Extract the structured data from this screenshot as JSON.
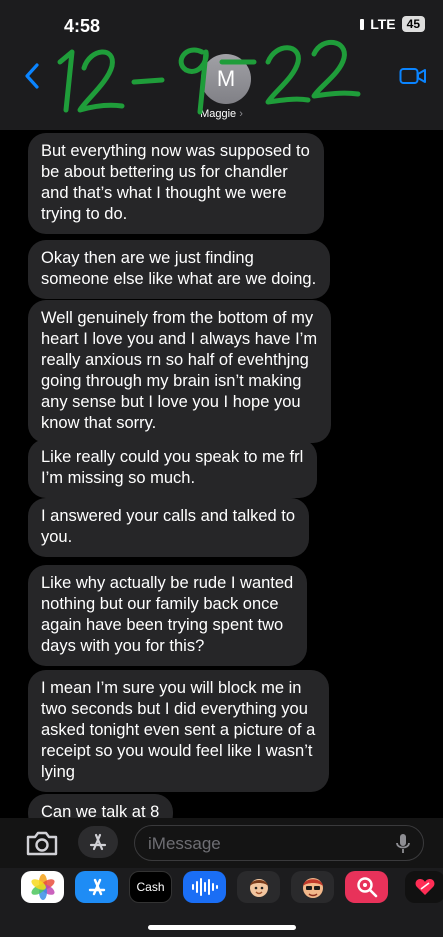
{
  "status_bar": {
    "time": "4:58",
    "network": "LTE",
    "battery": "45"
  },
  "contact": {
    "initial": "M",
    "name": "Maggie",
    "chevron": "›"
  },
  "annotation_text": "12-9-22",
  "messages": [
    {
      "lines": [
        "But everything now was supposed to",
        "be about bettering us for chandler",
        "and that’s what I thought we were",
        "trying to do."
      ]
    },
    {
      "lines": [
        "Okay then are we just finding",
        "someone else like what are we doing."
      ]
    },
    {
      "lines": [
        "Well genuinely from the bottom of my",
        "heart I love you and I always have I’m",
        "really anxious rn so half of evehthjng",
        "going through my brain isn’t making",
        "any sense but I love you I hope you",
        "know that sorry."
      ]
    },
    {
      "lines": [
        "Like really could you speak to me frl",
        "I’m missing so much."
      ]
    },
    {
      "lines": [
        "I answered your calls and talked to",
        "you."
      ]
    },
    {
      "lines": [
        "Like why actually be rude I wanted",
        "nothing but our family back once",
        "again have been trying spent two",
        "days with you for this?"
      ]
    },
    {
      "lines": [
        "I mean I’m sure you will block me in",
        "two seconds but I did everything you",
        "asked tonight even sent a picture of a",
        "receipt so you would feel like I wasn’t",
        "lying"
      ]
    },
    {
      "lines": [
        "Can we talk at 8"
      ]
    }
  ],
  "compose": {
    "placeholder": "iMessage"
  },
  "app_drawer": {
    "items": [
      {
        "icon": "photos-icon"
      },
      {
        "icon": "app-store-icon"
      },
      {
        "icon": "apple-cash-icon",
        "label": "Cash"
      },
      {
        "icon": "audio-message-icon"
      },
      {
        "icon": "memoji-icon"
      },
      {
        "icon": "memoji-stickers-icon"
      },
      {
        "icon": "image-search-icon"
      },
      {
        "icon": "digital-touch-icon"
      }
    ]
  },
  "colors": {
    "bubble_gray": "#262628",
    "ios_blue": "#0a84ff",
    "annotation_green": "#1f9d3a",
    "header_bg": "#1c1c1e"
  }
}
